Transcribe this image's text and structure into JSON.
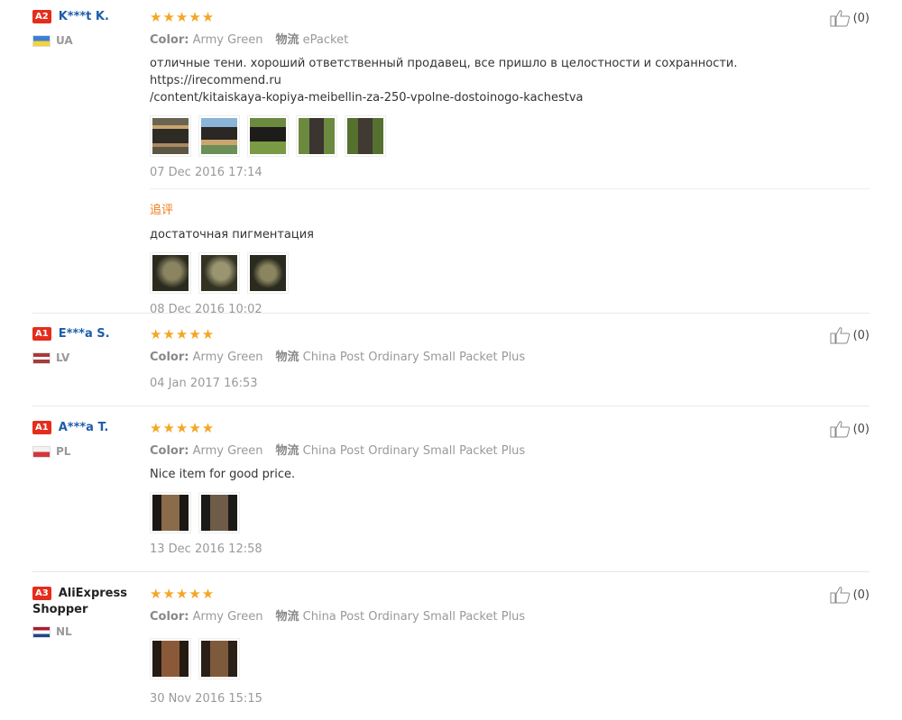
{
  "reviews": [
    {
      "level": "A2",
      "user": "K***t K.",
      "country": "UA",
      "flag": "ua",
      "stars": "★★★★★",
      "color_label": "Color:",
      "color_value": "Army Green",
      "ship_label": "物流",
      "ship_value": "ePacket",
      "text_line1": "отличные тени. хороший ответственный продавец, все пришло в целостности и сохранности. https://irecommend.ru",
      "text_line2": "/content/kitaiskaya-kopiya-meibellin-za-250-vpolne-dostoinogo-kachestva",
      "photos": [
        "photo",
        "photo",
        "photo",
        "photo",
        "photo"
      ],
      "date": "07 Dec 2016 17:14",
      "followup_label": "追评",
      "followup_text": "достаточная пигментация",
      "followup_photos": [
        "photo",
        "photo",
        "photo"
      ],
      "followup_date": "08 Dec 2016 10:02",
      "likes": "(0)"
    },
    {
      "level": "A1",
      "user": "E***a S.",
      "country": "LV",
      "flag": "lv",
      "stars": "★★★★★",
      "color_label": "Color:",
      "color_value": "Army Green",
      "ship_label": "物流",
      "ship_value": "China Post Ordinary Small Packet Plus",
      "date": "04 Jan 2017 16:53",
      "likes": "(0)"
    },
    {
      "level": "A1",
      "user": "A***a T.",
      "country": "PL",
      "flag": "pl",
      "stars": "★★★★★",
      "color_label": "Color:",
      "color_value": "Army Green",
      "ship_label": "物流",
      "ship_value": "China Post Ordinary Small Packet Plus",
      "text": "Nice item for good price.",
      "photos": [
        "photo",
        "photo"
      ],
      "date": "13 Dec 2016 12:58",
      "likes": "(0)"
    },
    {
      "level": "A3",
      "user_line1": "AliExpress",
      "user_line2": "Shopper",
      "country": "NL",
      "flag": "nl",
      "stars": "★★★★★",
      "color_label": "Color:",
      "color_value": "Army Green",
      "ship_label": "物流",
      "ship_value": "China Post Ordinary Small Packet Plus",
      "photos": [
        "photo",
        "photo"
      ],
      "date": "30 Nov 2016 15:15",
      "likes": "(0)"
    }
  ],
  "colors": {
    "link": "#1e5dab",
    "star": "#f5a623",
    "level_badge": "#e52d1b",
    "followup": "#f07c17"
  },
  "icons": {
    "like": "thumbs-up-icon"
  }
}
